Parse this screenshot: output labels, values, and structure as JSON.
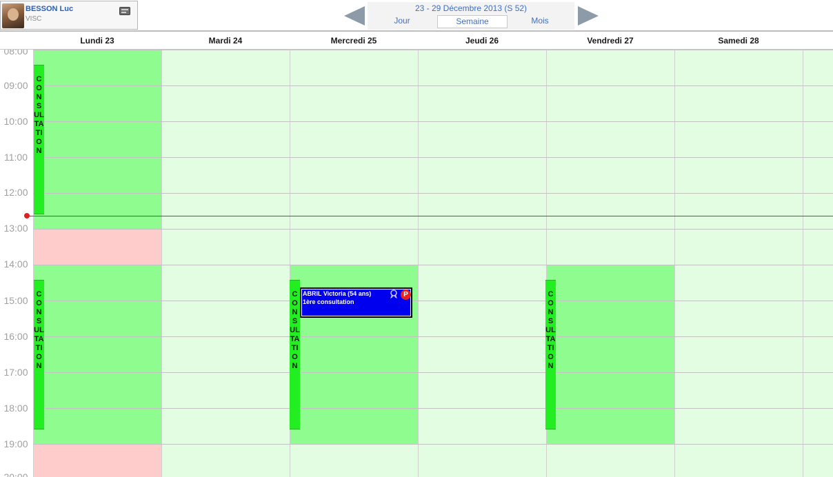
{
  "doctor": {
    "name": "BESSON Luc",
    "specialty": "VISC"
  },
  "navigation": {
    "week_range": "23 - 29 Décembre 2013 (S 52)",
    "tabs": {
      "day": "Jour",
      "week": "Semaine",
      "month": "Mois"
    },
    "active_tab": "Semaine"
  },
  "days": [
    "Lundi 23",
    "Mardi 24",
    "Mercredi 25",
    "Jeudi 26",
    "Vendredi 27",
    "Samedi 28"
  ],
  "time_labels": [
    "08:00",
    "09:00",
    "10:00",
    "11:00",
    "12:00",
    "13:00",
    "14:00",
    "15:00",
    "16:00",
    "17:00",
    "18:00",
    "19:00",
    "20:00"
  ],
  "consultation_label": "CONSULTATION",
  "consultation_blocks": [
    {
      "day": "Lundi 23",
      "start": "08:30",
      "end": "12:35"
    },
    {
      "day": "Lundi 23",
      "start": "14:30",
      "end": "18:35"
    },
    {
      "day": "Mercredi 25",
      "start": "14:30",
      "end": "18:35"
    },
    {
      "day": "Vendredi 27",
      "start": "14:30",
      "end": "18:35"
    }
  ],
  "current_time": "12:40",
  "appointment": {
    "patient": "ABRIL Victoria (54 ans)",
    "type": "1ère consultation",
    "badge": "P",
    "day": "Mercredi 25",
    "start": "14:40",
    "end": "15:30"
  },
  "colors": {
    "available": "#8ffc8f",
    "background": "#e2fde2",
    "unavailable": "#ffcccc",
    "consultation_bar": "#22ee22",
    "appointment": "#0000ee",
    "now_line": "#e02020",
    "header_text": "#3f6fc2"
  }
}
